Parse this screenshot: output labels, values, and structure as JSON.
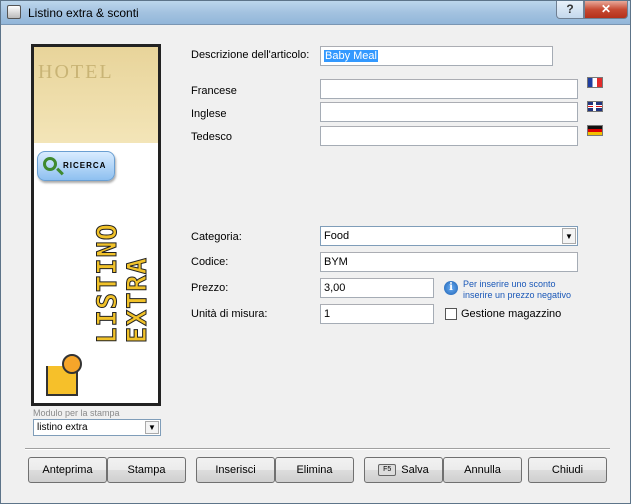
{
  "window": {
    "title": "Listino extra & sconti",
    "help_label": "?",
    "close_label": "✕"
  },
  "sidebar": {
    "banner_text": "HOTEL",
    "search_button": "RICERCA",
    "vertical_line1": "LISTINO",
    "vertical_line2": "EXTRA",
    "modulo_label": "Modulo per la stampa",
    "modulo_value": "listino extra"
  },
  "form": {
    "descrizione_label": "Descrizione dell'articolo:",
    "descrizione_value": "Baby Meal",
    "francese_label": "Francese",
    "inglese_label": "Inglese",
    "tedesco_label": "Tedesco",
    "categoria_label": "Categoria:",
    "categoria_value": "Food",
    "codice_label": "Codice:",
    "codice_value": "BYM",
    "prezzo_label": "Prezzo:",
    "prezzo_value": "3,00",
    "unita_label": "Unità di misura:",
    "unita_value": "1",
    "info_line1": "Per inserire uno sconto",
    "info_line2": "inserire un prezzo negativo",
    "gestione_label": "Gestione magazzino",
    "gestione_checked": false
  },
  "buttons": {
    "anteprima": "Anteprima",
    "stampa": "Stampa",
    "inserisci": "Inserisci",
    "elimina": "Elimina",
    "salva": "Salva",
    "salva_key": "F5",
    "annulla": "Annulla",
    "chiudi": "Chiudi"
  },
  "colors": {
    "accent": "#3399ff",
    "info": "#1a58b8",
    "close": "#c74a33"
  }
}
